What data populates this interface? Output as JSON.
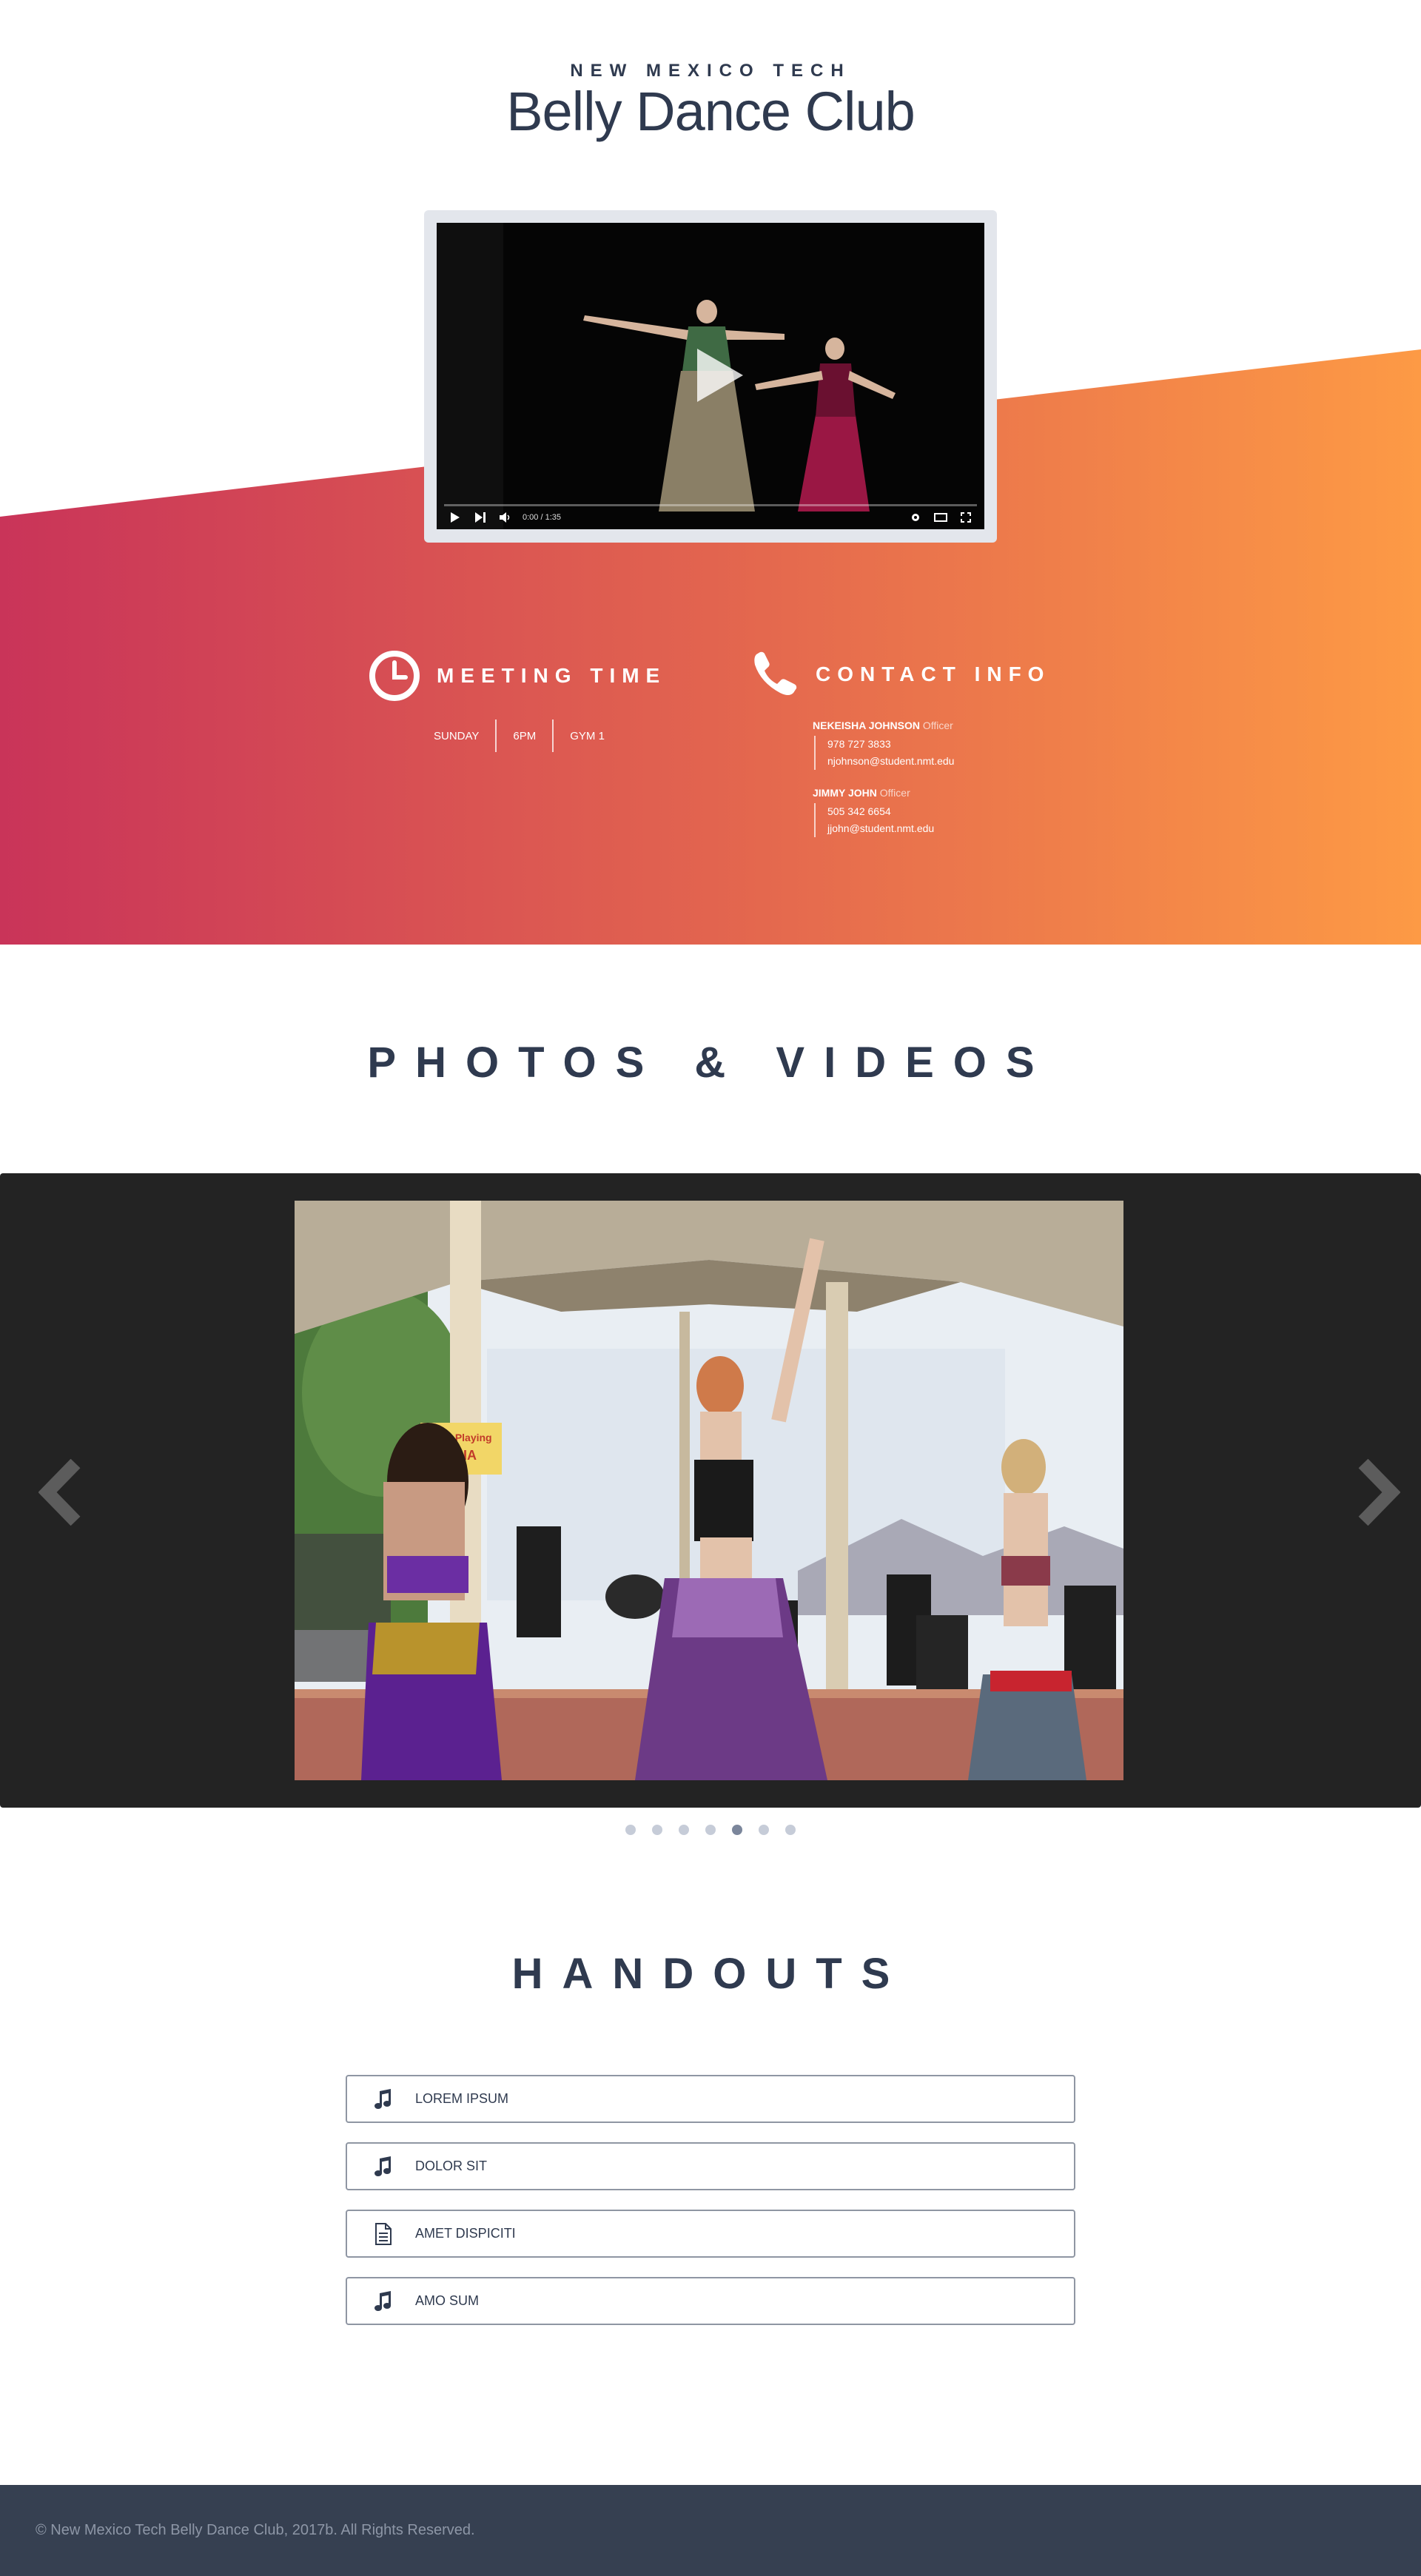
{
  "header": {
    "org": "NEW MEXICO TECH",
    "title": "Belly Dance Club"
  },
  "video": {
    "time": "0:00 / 1:35"
  },
  "meeting": {
    "label": "MEETING TIME",
    "day": "SUNDAY",
    "time": "6PM",
    "place": "GYM 1"
  },
  "contact": {
    "label": "CONTACT INFO",
    "people": [
      {
        "name": "NEKEISHA JOHNSON",
        "role": "Officer",
        "phone": "978 727 3833",
        "email": "njohnson@student.nmt.edu"
      },
      {
        "name": "JIMMY JOHN",
        "role": "Officer",
        "phone": "505 342 6654",
        "email": "jjohn@student.nmt.edu"
      }
    ]
  },
  "photos": {
    "title": "PHOTOS & VIDEOS",
    "slide_sign_text": [
      "Now Playing",
      "ALIA"
    ],
    "dot_count": 7,
    "active_dot": 5
  },
  "handouts": {
    "title": "HANDOUTS",
    "items": [
      {
        "label": "LOREM IPSUM",
        "icon": "music-note-icon"
      },
      {
        "label": "DOLOR SIT",
        "icon": "music-note-icon"
      },
      {
        "label": "AMET DISPICITI",
        "icon": "document-icon"
      },
      {
        "label": "AMO SUM",
        "icon": "music-note-icon"
      }
    ]
  },
  "footer": {
    "copyright": "© New Mexico Tech Belly Dance Club, 2017b. All Rights Reserved."
  },
  "colors": {
    "gradient_start": "#c93459",
    "gradient_end": "#fd9a45",
    "text_dark": "#2f3a4f",
    "footer_bg": "#364051",
    "carousel_bg": "#232323"
  }
}
